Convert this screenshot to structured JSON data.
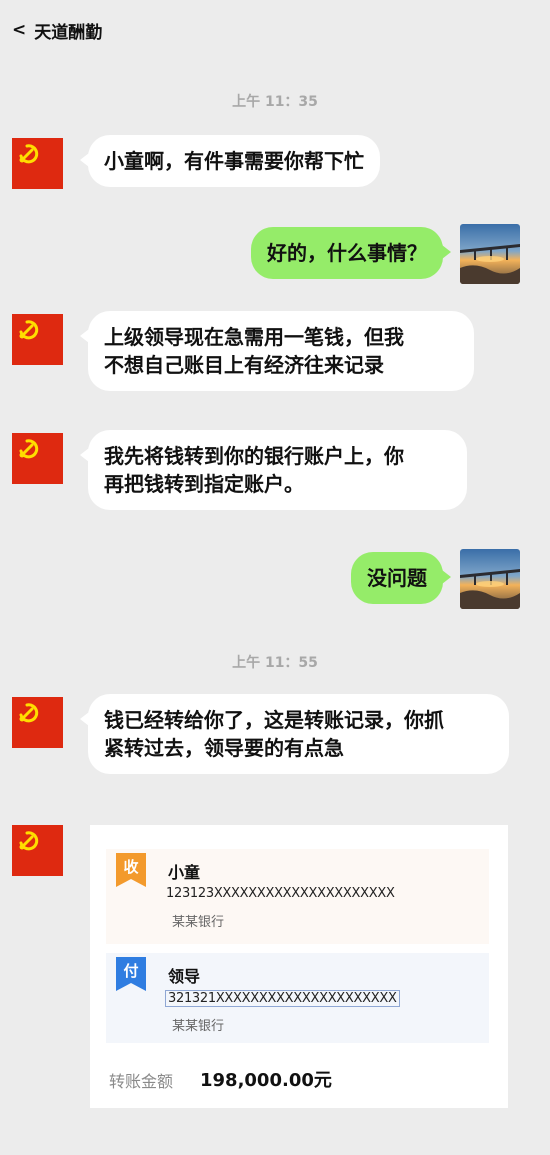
{
  "header": {
    "back_glyph": "<",
    "title": "天道酬勤"
  },
  "timestamps": [
    "上午 11：35",
    "上午 11：55"
  ],
  "messages": [
    {
      "side": "left",
      "text": "小童啊，有件事需要你帮下忙"
    },
    {
      "side": "right",
      "text": "好的，什么事情？"
    },
    {
      "side": "left",
      "line1": "上级领导现在急需用一笔钱，但我",
      "line2": "不想自己账目上有经济往来记录"
    },
    {
      "side": "left",
      "line1": "我先将钱转到你的银行账户上，你",
      "line2": "再把钱转到指定账户。"
    },
    {
      "side": "right",
      "text": "没问题"
    },
    {
      "side": "left",
      "line1": "钱已经转给你了，这是转账记录，你抓",
      "line2": "紧转过去，领导要的有点急"
    }
  ],
  "transfer": {
    "payee": {
      "tag": "收",
      "name": "小童",
      "account": "123123XXXXXXXXXXXXXXXXXXXXX",
      "bank": "某某银行"
    },
    "payer": {
      "tag": "付",
      "name": "领导",
      "account": "321321XXXXXXXXXXXXXXXXXXXXX",
      "bank": "某某银行"
    },
    "amount_label": "转账金额",
    "amount_value": "198,000.00元"
  },
  "colors": {
    "background": "#ececec",
    "bubble_left": "#ffffff",
    "bubble_right": "#95ec69",
    "flag_red": "#de2910",
    "flag_gold": "#ffde00",
    "tag_orange": "#f39a2c",
    "tag_blue": "#2f7de1"
  },
  "icons": {
    "contact_avatar": "party-flag-icon",
    "self_avatar": "bridge-sunset-photo"
  }
}
